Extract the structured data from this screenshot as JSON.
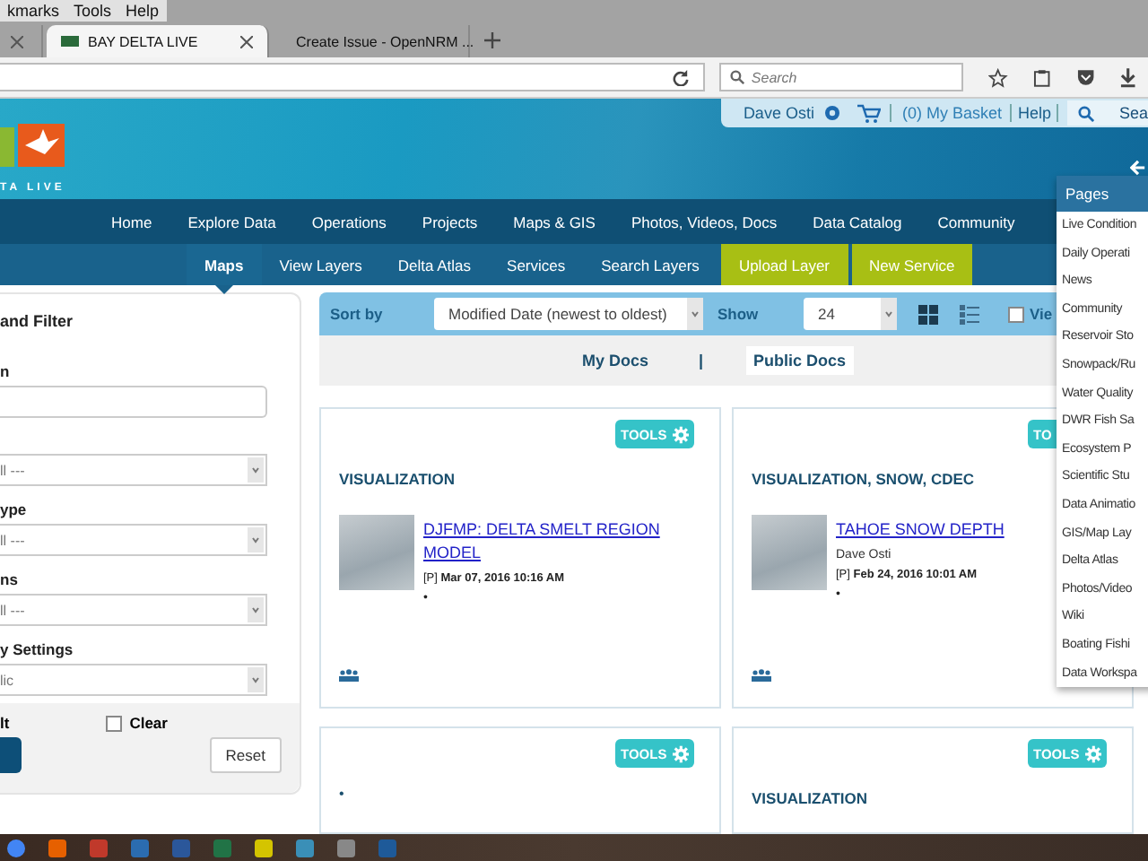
{
  "browser": {
    "menu": [
      "kmarks",
      "Tools",
      "Help"
    ],
    "tabs": [
      {
        "selected": false
      },
      {
        "title": "BAY DELTA LIVE",
        "selected": true
      },
      {
        "title": "Create Issue - OpenNRM ...",
        "selected": false
      }
    ],
    "search_placeholder": "Search"
  },
  "header": {
    "logo_text": "TA LIVE",
    "user": "Dave Osti",
    "basket": "(0) My Basket",
    "help": "Help",
    "search": "Sea"
  },
  "nav": [
    "Home",
    "Explore Data",
    "Operations",
    "Projects",
    "Maps & GIS",
    "Photos, Videos, Docs",
    "Data Catalog",
    "Community"
  ],
  "subnav": [
    {
      "label": "Maps",
      "selected": true,
      "kind": "link"
    },
    {
      "label": "View Layers",
      "selected": false,
      "kind": "link"
    },
    {
      "label": "Delta Atlas",
      "selected": false,
      "kind": "link"
    },
    {
      "label": "Services",
      "selected": false,
      "kind": "link"
    },
    {
      "label": "Search Layers",
      "selected": false,
      "kind": "link"
    },
    {
      "label": "Upload Layer",
      "selected": false,
      "kind": "action"
    },
    {
      "label": "New Service",
      "selected": false,
      "kind": "action"
    }
  ],
  "filter_panel": {
    "title": "and Filter",
    "fields": [
      {
        "label": "n",
        "kind": "text"
      },
      {
        "kind": "select",
        "value": "ll ---"
      },
      {
        "label": "ype",
        "kind": "select",
        "value": "ll ---"
      },
      {
        "label": "ns",
        "kind": "select",
        "value": "ll ---"
      },
      {
        "label": "y Settings",
        "kind": "select",
        "value": "lic"
      }
    ],
    "footer": {
      "label": "lt",
      "clear": {
        "label": "Clear",
        "checked": false
      },
      "reset": "Reset"
    }
  },
  "sort_bar": {
    "sort_label": "Sort by",
    "sort_value": "Modified Date (newest to oldest)",
    "show_label": "Show",
    "show_value": "24",
    "views": [
      {
        "kind": "grid",
        "selected": true
      },
      {
        "kind": "list",
        "selected": false
      }
    ],
    "view_toggle": {
      "label": "Vie",
      "checked": false
    }
  },
  "doc_tabs": [
    {
      "label": "My Docs",
      "selected": false
    },
    {
      "label": "Public Docs",
      "selected": true
    }
  ],
  "doc_separator": "|",
  "cards": [
    {
      "tools": "TOOLS",
      "category": "VISUALIZATION",
      "title": "DJFMP: DELTA SMELT REGION MODEL",
      "flag": "[P]",
      "date": "Mar 07, 2016 10:16 AM",
      "note": "•",
      "shared": true
    },
    {
      "tools": "TO",
      "category": "VISUALIZATION, SNOW, CDEC",
      "title": "TAHOE SNOW DEPTH",
      "author": "Dave Osti",
      "flag": "[P]",
      "date": "Feb 24, 2016 10:01 AM",
      "note": "•",
      "shared": true
    },
    {
      "tools": "TOOLS",
      "note": "•"
    },
    {
      "tools": "TOOLS",
      "category": "VISUALIZATION"
    }
  ],
  "pages_menu": {
    "title": "Pages",
    "items": [
      "Live Condition",
      "Daily Operati",
      "News",
      "Community",
      "Reservoir Sto",
      "Snowpack/Ru",
      "Water Quality",
      "DWR Fish Sa",
      "Ecosystem P",
      "Scientific Stu",
      "Data Animatio",
      "GIS/Map Lay",
      "Delta Atlas",
      "Photos/Video",
      "Wiki",
      "Boating Fishi",
      "Data Workspa"
    ]
  }
}
